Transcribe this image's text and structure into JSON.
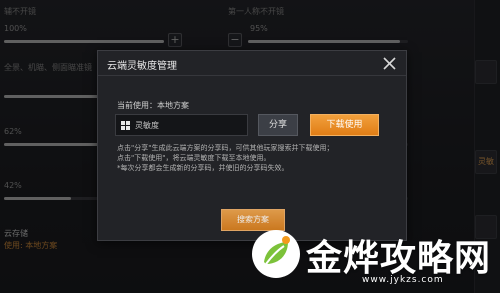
{
  "background": {
    "labels": [
      {
        "text": "辅不开镜",
        "x": 0
      },
      {
        "text": "第一人称不开镜",
        "x": 0
      }
    ],
    "percents": [
      "100%",
      "95%",
      "62%",
      "42%"
    ],
    "partial_text_left": "全景、机瞄、侧面瞄准镜",
    "bottom_label": "云存储",
    "bottom_sub": "使用: 本地方案",
    "side_button_label": "灵敏"
  },
  "dialog": {
    "title": "云端灵敏度管理",
    "current_use": "当前使用：本地方案",
    "field_value": "灵敏度",
    "share_label": "分享",
    "download_label": "下载使用",
    "description": [
      "点击\"分享\"生成此云端方案的分享码，可供其他玩家搜索并下载使用；",
      "点击\"下载使用\"，将云端灵敏度下载至本地使用。",
      "*每次分享都会生成新的分享码，并使旧的分享码失效。"
    ],
    "search_label": "搜索方案"
  },
  "watermark": {
    "brand": "金烨攻略网",
    "url": "www.jykzs.com"
  },
  "colors": {
    "accent_orange": "#e88a22",
    "dialog_bg": "#222327"
  }
}
